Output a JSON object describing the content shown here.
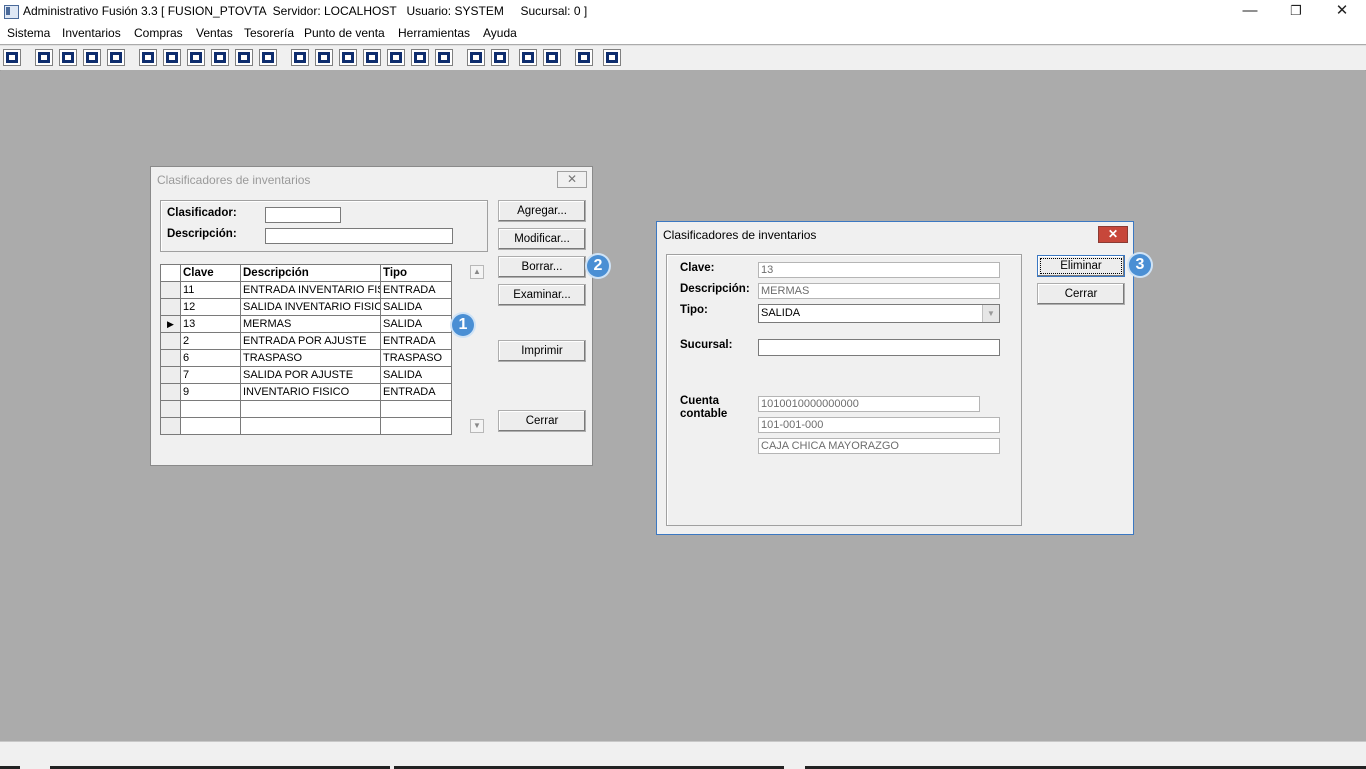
{
  "window": {
    "title": "Administrativo Fusión 3.3 [ FUSION_PTOVTA  Servidor: LOCALHOST   Usuario: SYSTEM     Sucursal: 0 ]",
    "minimize_glyph": "—",
    "maximize_glyph": "❐",
    "close_glyph": "✕"
  },
  "menu": [
    "Sistema",
    "Inventarios",
    "Compras",
    "Ventas",
    "Tesorería",
    "Punto de venta",
    "Herramientas",
    "Ayuda"
  ],
  "toolbar_icons": [
    "calc-icon",
    "copy-icon",
    "clipboard-icon",
    "transfer-icon",
    "search-icon",
    "user-icon",
    "folder-icon",
    "print-left-icon",
    "printer-icon",
    "document-icon",
    "list-icon",
    "users-icon",
    "open-folder-icon",
    "export-icon",
    "add-icon",
    "dollar-icon",
    "report-icon",
    "tree-icon",
    "home-icon",
    "zoom-icon",
    "refresh-icon",
    "undo-icon",
    "back-arrow-icon",
    "help-icon"
  ],
  "list_dialog": {
    "title": "Clasificadores de inventarios",
    "close_glyph": "✕",
    "filter": {
      "clasificador_label": "Clasificador:",
      "clasificador_value": "",
      "descripcion_label": "Descripción:",
      "descripcion_value": ""
    },
    "columns": [
      "Clave",
      "Descripción",
      "Tipo"
    ],
    "rows": [
      {
        "clave": "11",
        "descripcion": "ENTRADA INVENTARIO FIS:",
        "tipo": "ENTRADA",
        "marker": ""
      },
      {
        "clave": "12",
        "descripcion": "SALIDA INVENTARIO FISIC",
        "tipo": "SALIDA",
        "marker": ""
      },
      {
        "clave": "13",
        "descripcion": "MERMAS",
        "tipo": "SALIDA",
        "marker": "▶"
      },
      {
        "clave": "2",
        "descripcion": "ENTRADA POR AJUSTE",
        "tipo": "ENTRADA",
        "marker": ""
      },
      {
        "clave": "6",
        "descripcion": "TRASPASO",
        "tipo": "TRASPASO",
        "marker": ""
      },
      {
        "clave": "7",
        "descripcion": "SALIDA POR AJUSTE",
        "tipo": "SALIDA",
        "marker": ""
      },
      {
        "clave": "9",
        "descripcion": "INVENTARIO FISICO",
        "tipo": "ENTRADA",
        "marker": ""
      },
      {
        "clave": "",
        "descripcion": "",
        "tipo": "",
        "marker": ""
      },
      {
        "clave": "",
        "descripcion": "",
        "tipo": "",
        "marker": ""
      }
    ],
    "buttons": {
      "agregar": "Agregar...",
      "modificar": "Modificar...",
      "borrar": "Borrar...",
      "examinar": "Examinar...",
      "imprimir": "Imprimir",
      "cerrar": "Cerrar"
    },
    "scroll_up": "▲",
    "scroll_down": "▼"
  },
  "detail_dialog": {
    "title": "Clasificadores de inventarios",
    "close_glyph": "✕",
    "clave_label": "Clave:",
    "clave_value": "13",
    "descripcion_label": "Descripción:",
    "descripcion_value": "MERMAS",
    "tipo_label": "Tipo:",
    "tipo_value": "SALIDA",
    "tipo_arrow": "▼",
    "sucursal_label": "Sucursal:",
    "sucursal_value": "",
    "cuenta_label": "Cuenta contable",
    "cuenta_numero": "1010010000000000",
    "cuenta_codigo": "101-001-000",
    "cuenta_nombre": "CAJA CHICA MAYORAZGO",
    "buttons": {
      "eliminar": "Eliminar",
      "cerrar": "Cerrar"
    }
  },
  "badges": {
    "one": "1",
    "two": "2",
    "three": "3"
  },
  "colors": {
    "badge": "#4a8fd4",
    "close_red": "#c7473a",
    "desktop": "#ababab"
  }
}
